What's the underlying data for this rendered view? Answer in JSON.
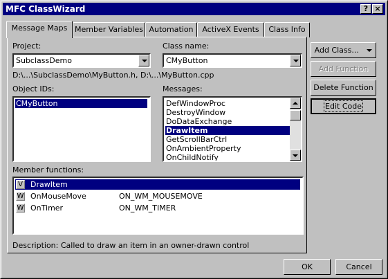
{
  "window": {
    "title": "MFC ClassWizard",
    "help_glyph": "?",
    "close_glyph": "×"
  },
  "tabs": [
    "Message Maps",
    "Member Variables",
    "Automation",
    "ActiveX Events",
    "Class Info"
  ],
  "project": {
    "label": "Project:",
    "value": "SubclassDemo"
  },
  "class_name": {
    "label": "Class name:",
    "value": "CMyButton"
  },
  "files_path": "D:\\...\\SubclassDemo\\MyButton.h, D:\\...\\MyButton.cpp",
  "object_ids": {
    "label": "Object IDs:",
    "items": [
      "CMyButton"
    ],
    "selected": 0
  },
  "messages": {
    "label": "Messages:",
    "items": [
      "DefWindowProc",
      "DestroyWindow",
      "DoDataExchange",
      "DrawItem",
      "GetScrollBarCtrl",
      "OnAmbientProperty",
      "OnChildNotify"
    ],
    "selected": 3
  },
  "member_functions": {
    "label": "Member functions:",
    "rows": [
      {
        "type": "V",
        "name": "DrawItem",
        "map": ""
      },
      {
        "type": "W",
        "name": "OnMouseMove",
        "map": "ON_WM_MOUSEMOVE"
      },
      {
        "type": "W",
        "name": "OnTimer",
        "map": "ON_WM_TIMER"
      }
    ],
    "selected": 0
  },
  "description": "Description:  Called to draw an item in an owner-drawn control",
  "buttons": {
    "add_class": "Add Class...",
    "add_function": "Add Function",
    "delete_function": "Delete Function",
    "edit_code": "Edit Code",
    "ok": "OK",
    "cancel": "Cancel"
  },
  "colors": {
    "title_bar": "#000080",
    "selection": "#000080",
    "face": "#c0c0c0"
  }
}
